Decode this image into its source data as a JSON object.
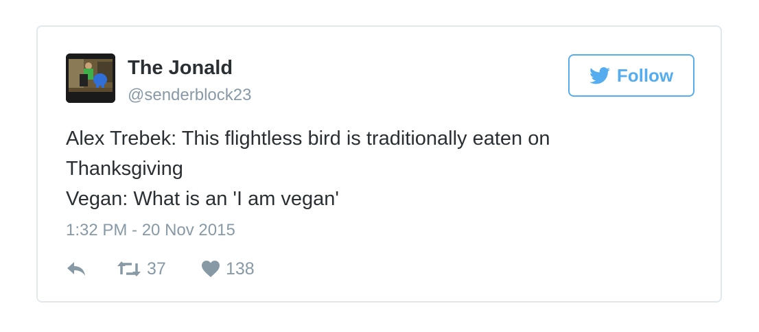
{
  "tweet": {
    "author": {
      "name": "The Jonald",
      "handle": "@senderblock23",
      "avatar_icon": "user-avatar-photo"
    },
    "follow_button": {
      "label": "Follow",
      "icon": "twitter-bird-icon",
      "color": "#55acee"
    },
    "text_lines": [
      "Alex Trebek: This flightless bird is traditionally eaten on",
      "Thanksgiving",
      "Vegan: What is an 'I am vegan'"
    ],
    "timestamp": "1:32 PM - 20 Nov 2015",
    "actions": {
      "reply": {
        "icon": "reply-icon"
      },
      "retweet": {
        "icon": "retweet-icon",
        "count": "37"
      },
      "like": {
        "icon": "heart-icon",
        "count": "138"
      }
    },
    "colors": {
      "text": "#292f33",
      "muted": "#8899a6",
      "border": "#e1e8ed",
      "accent": "#55acee"
    }
  }
}
